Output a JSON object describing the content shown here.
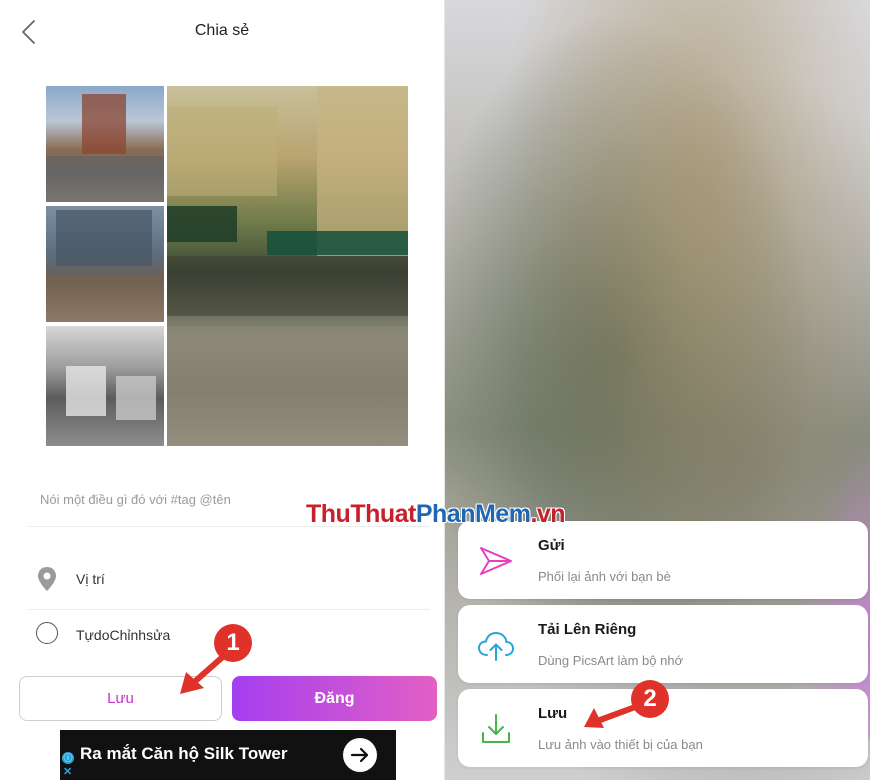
{
  "header": {
    "title": "Chia sẻ"
  },
  "compose": {
    "caption_placeholder": "Nói một điều gì đó với #tag @tên"
  },
  "options": {
    "location_label": "Vị trí",
    "free_edit_label": "TựdoChỉnhsửa"
  },
  "buttons": {
    "save_label": "Lưu",
    "post_label": "Đăng"
  },
  "ad": {
    "text": "Ra mắt Căn hộ Silk Tower",
    "info_symbol": "ⓘ",
    "close_symbol": "✕"
  },
  "share_sheet": {
    "items": [
      {
        "title": "Gửi",
        "subtitle": "Phối lại ảnh với bạn bè",
        "icon": "send-icon",
        "color": "#e83fc1"
      },
      {
        "title": "Tải Lên Riêng",
        "subtitle": "Dùng PicsArt làm bộ nhớ",
        "icon": "cloud-upload-icon",
        "color": "#2aa3d8"
      },
      {
        "title": "Lưu",
        "subtitle": "Lưu ảnh vào thiết bị của bạn",
        "icon": "download-icon",
        "color": "#47b34a"
      }
    ]
  },
  "watermark": {
    "part1": "ThuThuat",
    "part2": "PhanMem",
    "part3": ".vn"
  },
  "markers": {
    "first": "1",
    "second": "2"
  },
  "colors": {
    "accent_purple": "#c233c6",
    "gradient_start": "#a43ff0",
    "gradient_end": "#e35fc4",
    "marker_red": "#e0322a"
  }
}
